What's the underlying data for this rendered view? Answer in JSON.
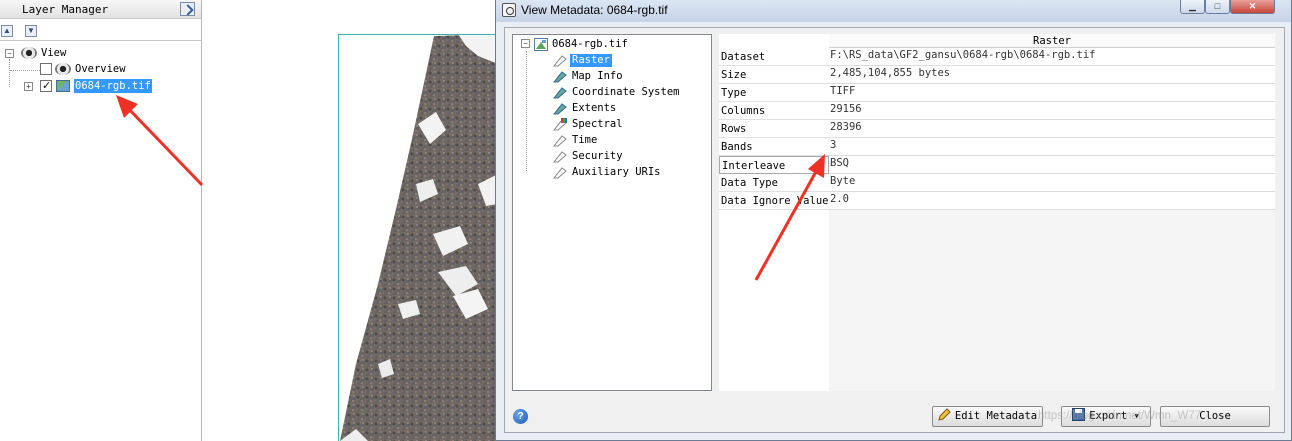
{
  "layer_manager": {
    "title": "Layer Manager",
    "tree": {
      "root_label": "View",
      "items": [
        {
          "label": "Overview",
          "checked": false
        },
        {
          "label": "0684-rgb.tif",
          "checked": true,
          "selected": true
        }
      ]
    }
  },
  "dialog": {
    "title": "View Metadata: 0684-rgb.tif",
    "tree": {
      "root": "0684-rgb.tif",
      "items": [
        "Raster",
        "Map Info",
        "Coordinate System",
        "Extents",
        "Spectral",
        "Time",
        "Security",
        "Auxiliary URIs"
      ],
      "selected": "Raster"
    },
    "table": {
      "column_header": "Raster",
      "rows": [
        {
          "key": "Dataset",
          "value": "F:\\RS_data\\GF2_gansu\\0684-rgb\\0684-rgb.tif"
        },
        {
          "key": "Size",
          "value": "2,485,104,855 bytes"
        },
        {
          "key": "Type",
          "value": "TIFF"
        },
        {
          "key": "Columns",
          "value": "29156"
        },
        {
          "key": "Rows",
          "value": "28396"
        },
        {
          "key": "Bands",
          "value": "3"
        },
        {
          "key": "Interleave",
          "value": "BSQ"
        },
        {
          "key": "Data Type",
          "value": "Byte"
        },
        {
          "key": "Data Ignore Value",
          "value": "2.0"
        }
      ]
    },
    "buttons": {
      "edit_metadata": "Edit Metadata",
      "export": "Export",
      "close": "Close"
    }
  },
  "watermark": "https://blog.csdn.net/Wmn_W77",
  "colors": {
    "selection": "#3399ff",
    "arrow": "#ee3124",
    "frame": "#3ab6b0"
  }
}
